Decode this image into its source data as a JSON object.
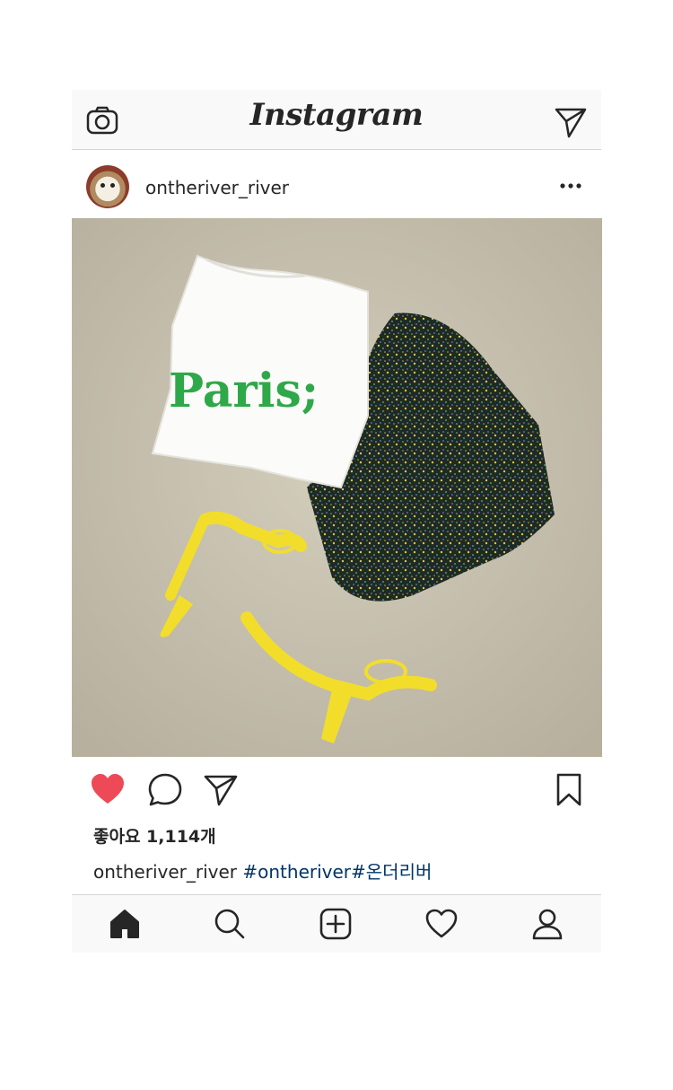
{
  "app": {
    "logo": "Instagram"
  },
  "topbar": {
    "camera_icon": "camera-icon",
    "direct_icon": "paper-plane-icon"
  },
  "post": {
    "username": "ontheriver_river",
    "more_icon": "more-dots-icon",
    "image": {
      "description_text": "Paris;",
      "colors": {
        "floor": "#c9c3b3",
        "shirt": "#ffffff",
        "sequin": "#2fa84a",
        "skirt": "#1e2a22",
        "sandals": "#f2de2a"
      }
    },
    "actions": {
      "like_icon": "heart-filled-icon",
      "comment_icon": "comment-icon",
      "share_icon": "paper-plane-icon",
      "save_icon": "bookmark-icon"
    },
    "likes_text": "좋아요 1,114개",
    "caption": {
      "username": "ontheriver_river",
      "hashtags": "#ontheriver#온더리버"
    }
  },
  "bottom_nav": [
    {
      "name": "home-icon",
      "active": true
    },
    {
      "name": "search-icon",
      "active": false
    },
    {
      "name": "new-post-icon",
      "active": false
    },
    {
      "name": "activity-heart-icon",
      "active": false
    },
    {
      "name": "profile-icon",
      "active": false
    }
  ],
  "colors": {
    "like_red": "#ed4956",
    "hashtag_blue": "#003569",
    "bar_bg": "#f9f9f9",
    "divider": "#d4d4d4"
  }
}
